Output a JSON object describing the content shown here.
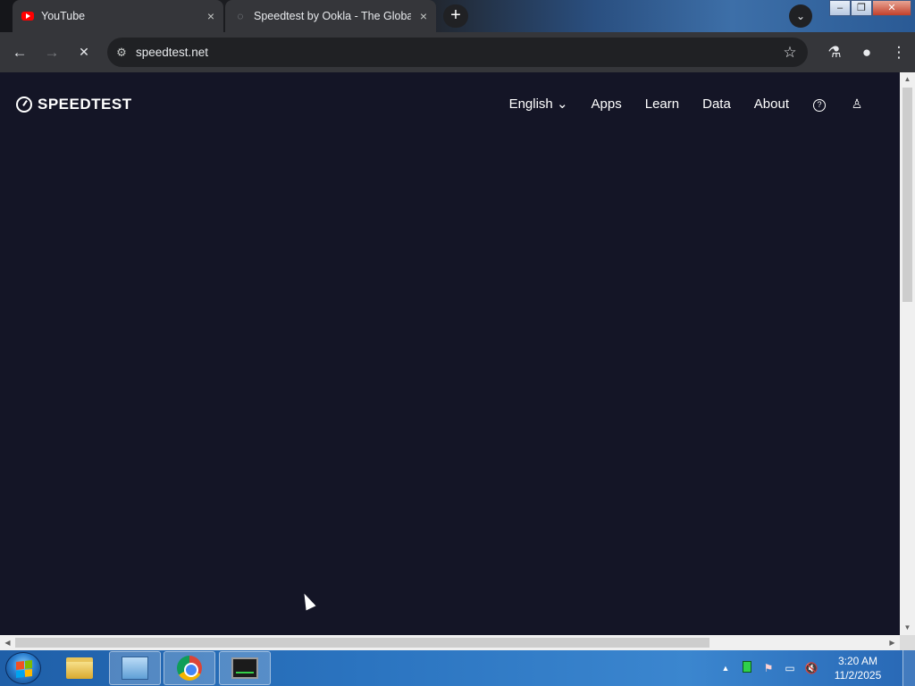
{
  "browser": {
    "tabs": [
      {
        "title": "YouTube",
        "icon": "youtube-icon",
        "close": "×"
      },
      {
        "title": "Speedtest by Ookla - The Global",
        "icon": "loading-icon",
        "close": "×"
      }
    ],
    "new_tab_label": "+",
    "tab_search_label": "⌄",
    "window_buttons": {
      "minimize": "–",
      "restore": "❐",
      "close": "✕"
    },
    "nav": {
      "back": "←",
      "forward": "→",
      "stop": "✕"
    },
    "address": {
      "url": "speedtest.net",
      "site_info_icon": "tune-icon"
    },
    "toolbar_right": {
      "star": "☆",
      "labs": "⚗",
      "profile": "●",
      "menu": "⋮"
    }
  },
  "page": {
    "brand": "SPEEDTEST",
    "nav": {
      "language": "English",
      "language_chevron": "⌄",
      "apps": "Apps",
      "learn": "Learn",
      "data": "Data",
      "about": "About",
      "help": "?",
      "account": "♙"
    },
    "background_color": "#141526"
  },
  "taskbar": {
    "tray": {
      "show_hidden": "▲",
      "clock_time": "3:20 AM",
      "clock_date": "11/2/2025"
    }
  }
}
